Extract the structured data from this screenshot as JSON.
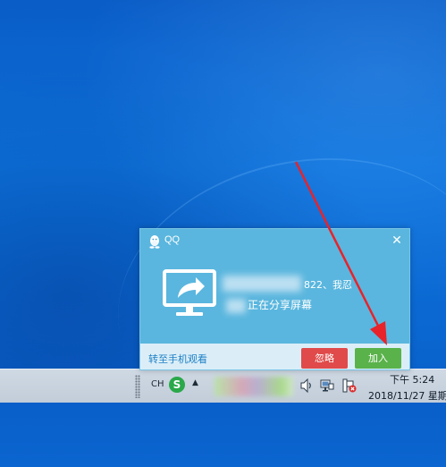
{
  "notification": {
    "app_title": "QQ",
    "close_glyph": "✕",
    "sender": "822、我忍",
    "message": "正在分享屏幕",
    "mobile_link": "转至手机观看",
    "ignore_label": "忽略",
    "join_label": "加入",
    "icon": "screen-share-icon",
    "colors": {
      "background": "#5ab6de",
      "footer": "#dbeef8",
      "ignore_button": "#e04a4a",
      "join_button": "#59b24a",
      "link": "#1c7fc4"
    }
  },
  "taskbar": {
    "input_language": "CH",
    "ime_label": "S",
    "overflow_glyph": "▲",
    "time": "下午 5:24",
    "date": "2018/11/27 星期",
    "tray_icons": [
      "volume-icon",
      "network-icon",
      "action-center-icon"
    ]
  },
  "annotation": {
    "arrow_color": "#e8232a"
  }
}
